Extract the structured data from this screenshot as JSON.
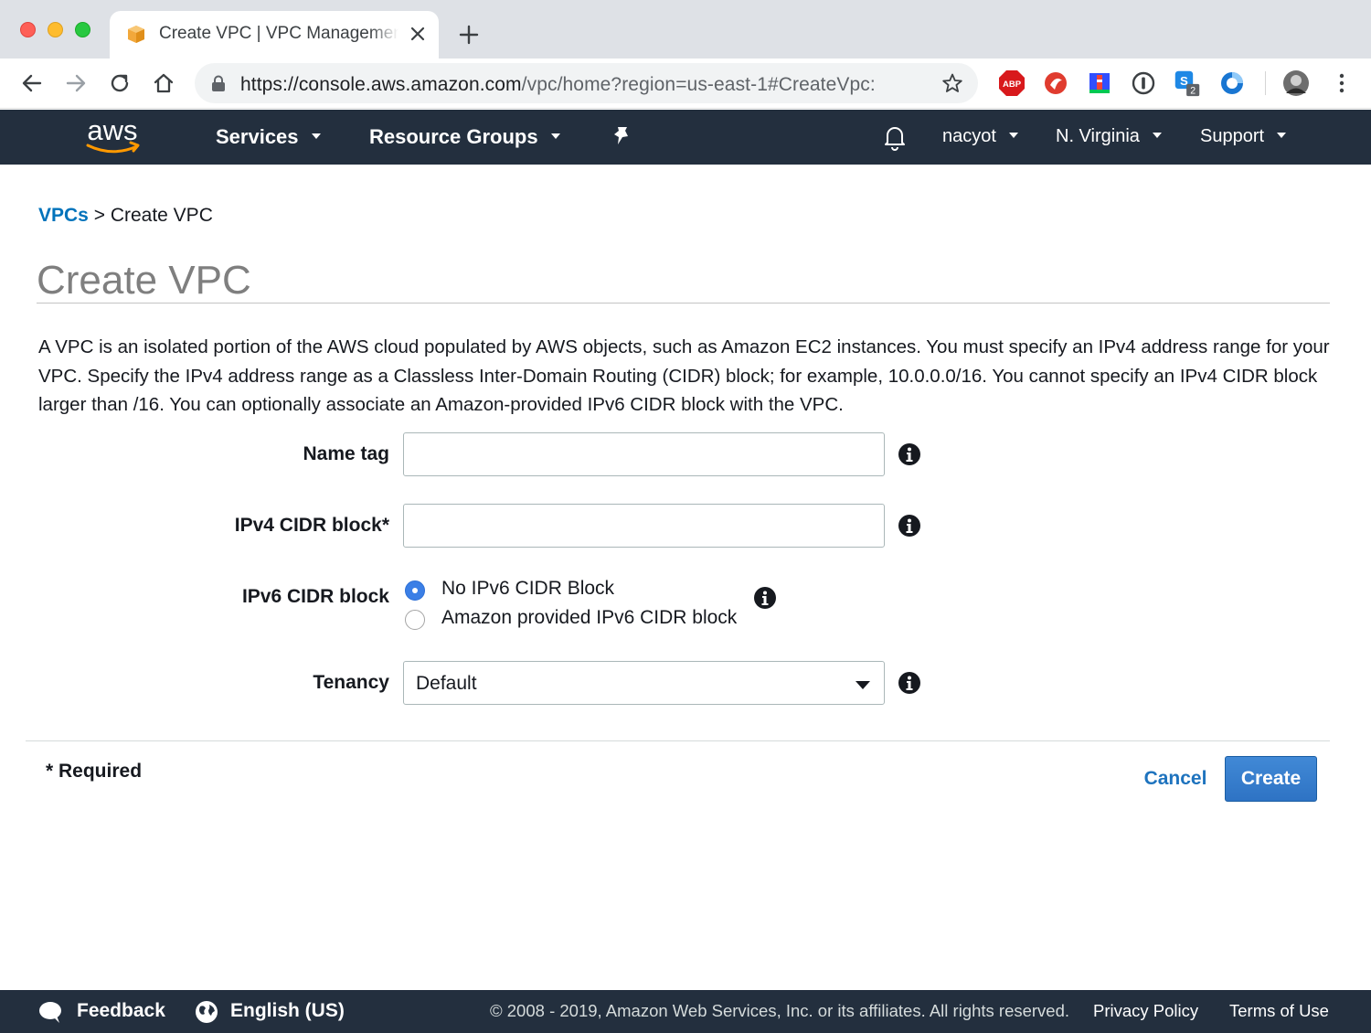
{
  "browser": {
    "tab_title": "Create VPC | VPC Management Console",
    "url_host": "https://console.aws.amazon.com",
    "url_path": "/vpc/home?region=us-east-1#CreateVpc:",
    "extension_badge": "2",
    "abp_label": "ABP"
  },
  "aws_nav": {
    "logo_text": "aws",
    "services": "Services",
    "resource_groups": "Resource Groups",
    "user": "nacyot",
    "region": "N. Virginia",
    "support": "Support"
  },
  "breadcrumb": {
    "root": "VPCs",
    "separator": ">",
    "current": "Create VPC"
  },
  "page": {
    "title": "Create VPC",
    "description": "A VPC is an isolated portion of the AWS cloud populated by AWS objects, such as Amazon EC2 instances. You must specify an IPv4 address range for your VPC. Specify the IPv4 address range as a Classless Inter-Domain Routing (CIDR) block; for example, 10.0.0.0/16. You cannot specify an IPv4 CIDR block larger than /16. You can optionally associate an Amazon-provided IPv6 CIDR block with the VPC."
  },
  "form": {
    "name_tag": {
      "label": "Name tag",
      "value": ""
    },
    "ipv4_cidr": {
      "label": "IPv4 CIDR block*",
      "value": ""
    },
    "ipv6_cidr": {
      "label": "IPv6 CIDR block",
      "options": [
        "No IPv6 CIDR Block",
        "Amazon provided IPv6 CIDR block"
      ],
      "selected": "No IPv6 CIDR Block"
    },
    "tenancy": {
      "label": "Tenancy",
      "selected": "Default"
    },
    "required_note": "* Required",
    "cancel": "Cancel",
    "create": "Create"
  },
  "footer": {
    "feedback": "Feedback",
    "language": "English (US)",
    "copyright": "© 2008 - 2019, Amazon Web Services, Inc. or its affiliates. All rights reserved.",
    "privacy": "Privacy Policy",
    "terms": "Terms of Use"
  },
  "colors": {
    "aws_nav_bg": "#232f3e",
    "link_blue": "#0073bb",
    "primary_button": "#2e73c4",
    "radio_selected": "#3b7fe6"
  }
}
